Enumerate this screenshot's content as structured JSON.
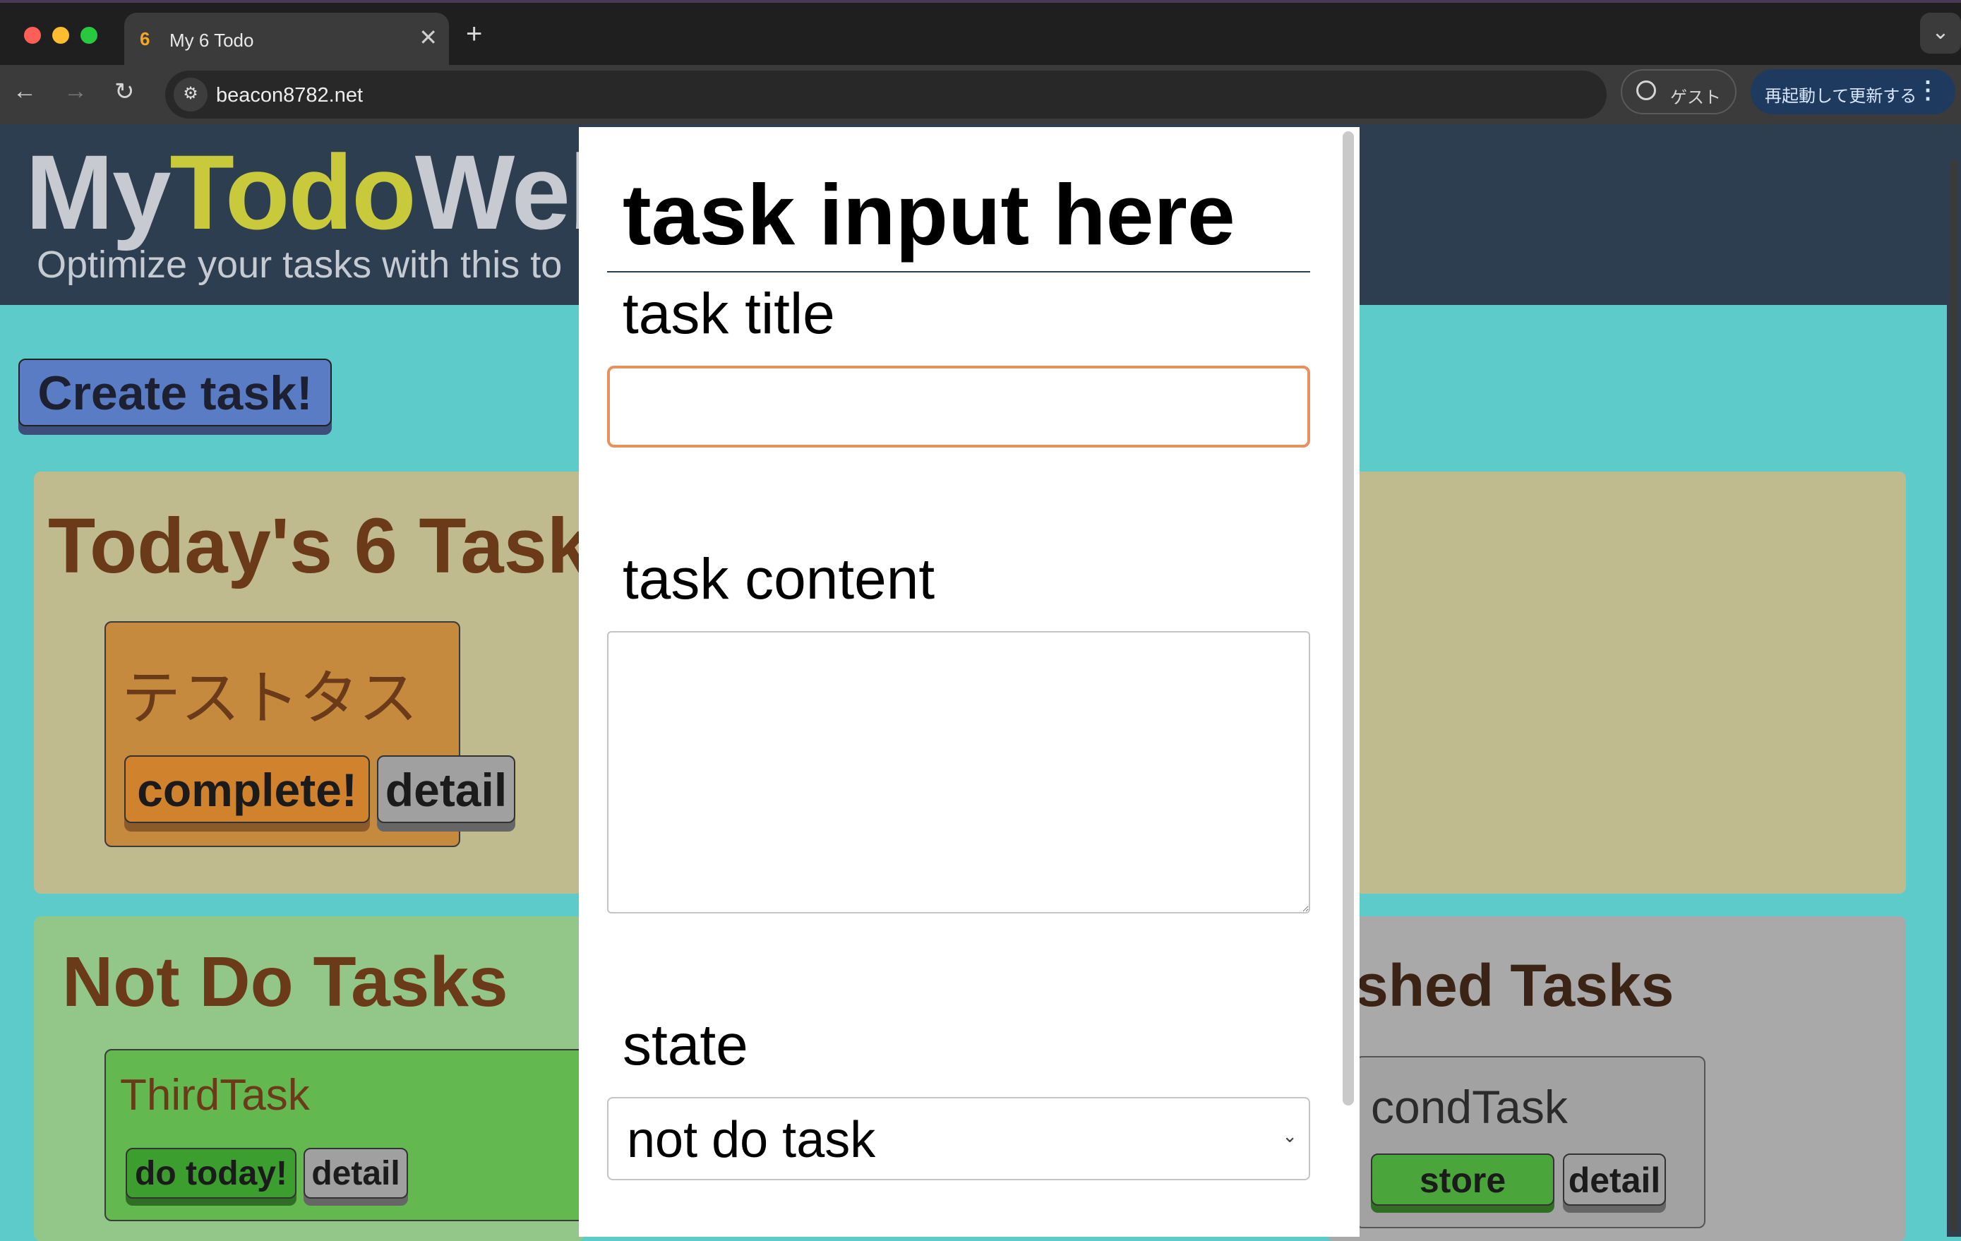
{
  "browser": {
    "tab_title": "My 6 Todo",
    "tab_favicon": "6",
    "url": "beacon8782.net",
    "guest_label": "ゲスト",
    "restart_label": "再起動して更新する",
    "colors": {
      "tabbar": "#1f1f1f",
      "toolbar": "#3b3b3b"
    }
  },
  "header": {
    "logo_part1": "My",
    "logo_part2": "Todo",
    "logo_part3": "Web",
    "tagline": "Optimize your tasks with this to",
    "colors": {
      "background": "#2c3e50",
      "accent": "#c9c93c"
    }
  },
  "create_button": "Create task!",
  "today": {
    "heading": "Today's 6 Task",
    "card": {
      "title": "テストタスク",
      "complete_label": "complete!",
      "detail_label": "detail"
    }
  },
  "not_do": {
    "heading": "Not Do Tasks",
    "card": {
      "title": "ThirdTask",
      "do_today_label": "do today!",
      "detail_label": "detail"
    }
  },
  "finished": {
    "heading": "shed Tasks",
    "card": {
      "title": "condTask",
      "restore_label": "store",
      "detail_label": "detail"
    }
  },
  "modal": {
    "heading": "task input here",
    "title_label": "task title",
    "title_value": "",
    "content_label": "task content",
    "content_value": "",
    "state_label": "state",
    "state_value": "not do task"
  }
}
